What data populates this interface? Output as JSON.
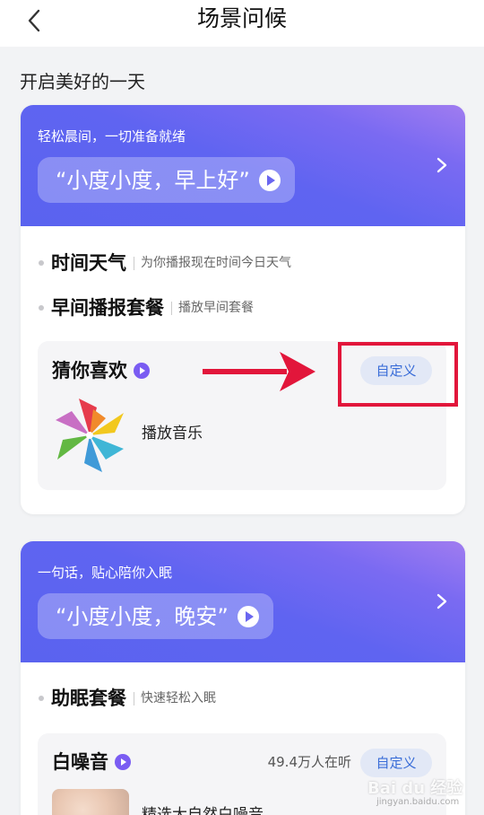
{
  "header": {
    "title": "场景问候"
  },
  "section_title": "开启美好的一天",
  "morning_card": {
    "subtitle": "轻松晨间，一切准备就绪",
    "phrase": "“小度小度，早上好”",
    "features": [
      {
        "title": "时间天气",
        "desc": "为你播报现在时间今日天气"
      },
      {
        "title": "早间播报套餐",
        "desc": "播放早间套餐"
      }
    ],
    "box": {
      "title": "猜你喜欢",
      "custom_label": "自定义",
      "item_label": "播放音乐"
    }
  },
  "night_card": {
    "subtitle": "一句话，贴心陪你入眠",
    "phrase": "“小度小度，晚安”",
    "features": [
      {
        "title": "助眠套餐",
        "desc": "快速轻松入眠"
      }
    ],
    "box": {
      "title": "白噪音",
      "listeners": "49.4万人在听",
      "custom_label": "自定义",
      "item_label": "精选大自然白噪音"
    }
  },
  "watermark": {
    "text": "Bai du 经验",
    "sub": "jingyan.baidu.com"
  },
  "colors": {
    "accent": "#3a6dd8",
    "banner": "#5f64f1",
    "annotation": "#e2163b",
    "play": "#7a5cf2"
  }
}
